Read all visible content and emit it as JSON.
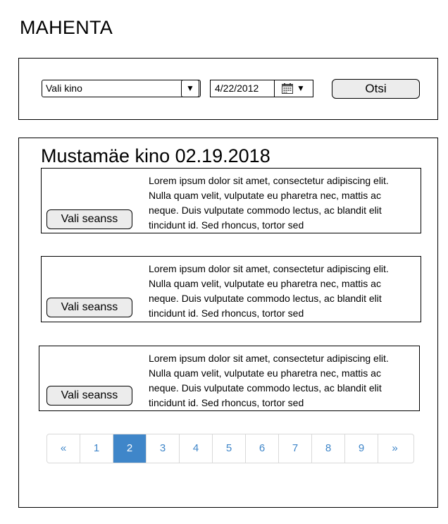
{
  "app": {
    "title": "MAHENTA"
  },
  "search": {
    "cinema_select_value": "Vali kino",
    "dropdown_arrow": "▼",
    "date_value": "4/22/2012",
    "calendar_arrow": "▼",
    "submit_label": "Otsi"
  },
  "results": {
    "title": "Mustamäe kino 02.19.2018",
    "cards": [
      {
        "button_label": "Vali seanss",
        "text": "Lorem ipsum dolor sit amet, consectetur adipiscing elit. Nulla quam velit, vulputate eu pharetra nec, mattis ac neque. Duis vulputate commodo lectus, ac blandit elit tincidunt id. Sed rhoncus, tortor sed"
      },
      {
        "button_label": "Vali seanss",
        "text": "Lorem ipsum dolor sit amet, consectetur adipiscing elit. Nulla quam velit, vulputate eu pharetra nec, mattis ac neque. Duis vulputate commodo lectus, ac blandit elit tincidunt id. Sed rhoncus, tortor sed"
      },
      {
        "button_label": "Vali seanss",
        "text": "Lorem ipsum dolor sit amet, consectetur adipiscing elit. Nulla quam velit, vulputate eu pharetra nec, mattis ac neque. Duis vulputate commodo lectus, ac blandit elit tincidunt id. Sed rhoncus, tortor sed"
      }
    ]
  },
  "pagination": {
    "items": [
      "«",
      "1",
      "2",
      "3",
      "4",
      "5",
      "6",
      "7",
      "8",
      "9",
      "»"
    ],
    "active_index": 2,
    "accent_color": "#3f86c9"
  }
}
